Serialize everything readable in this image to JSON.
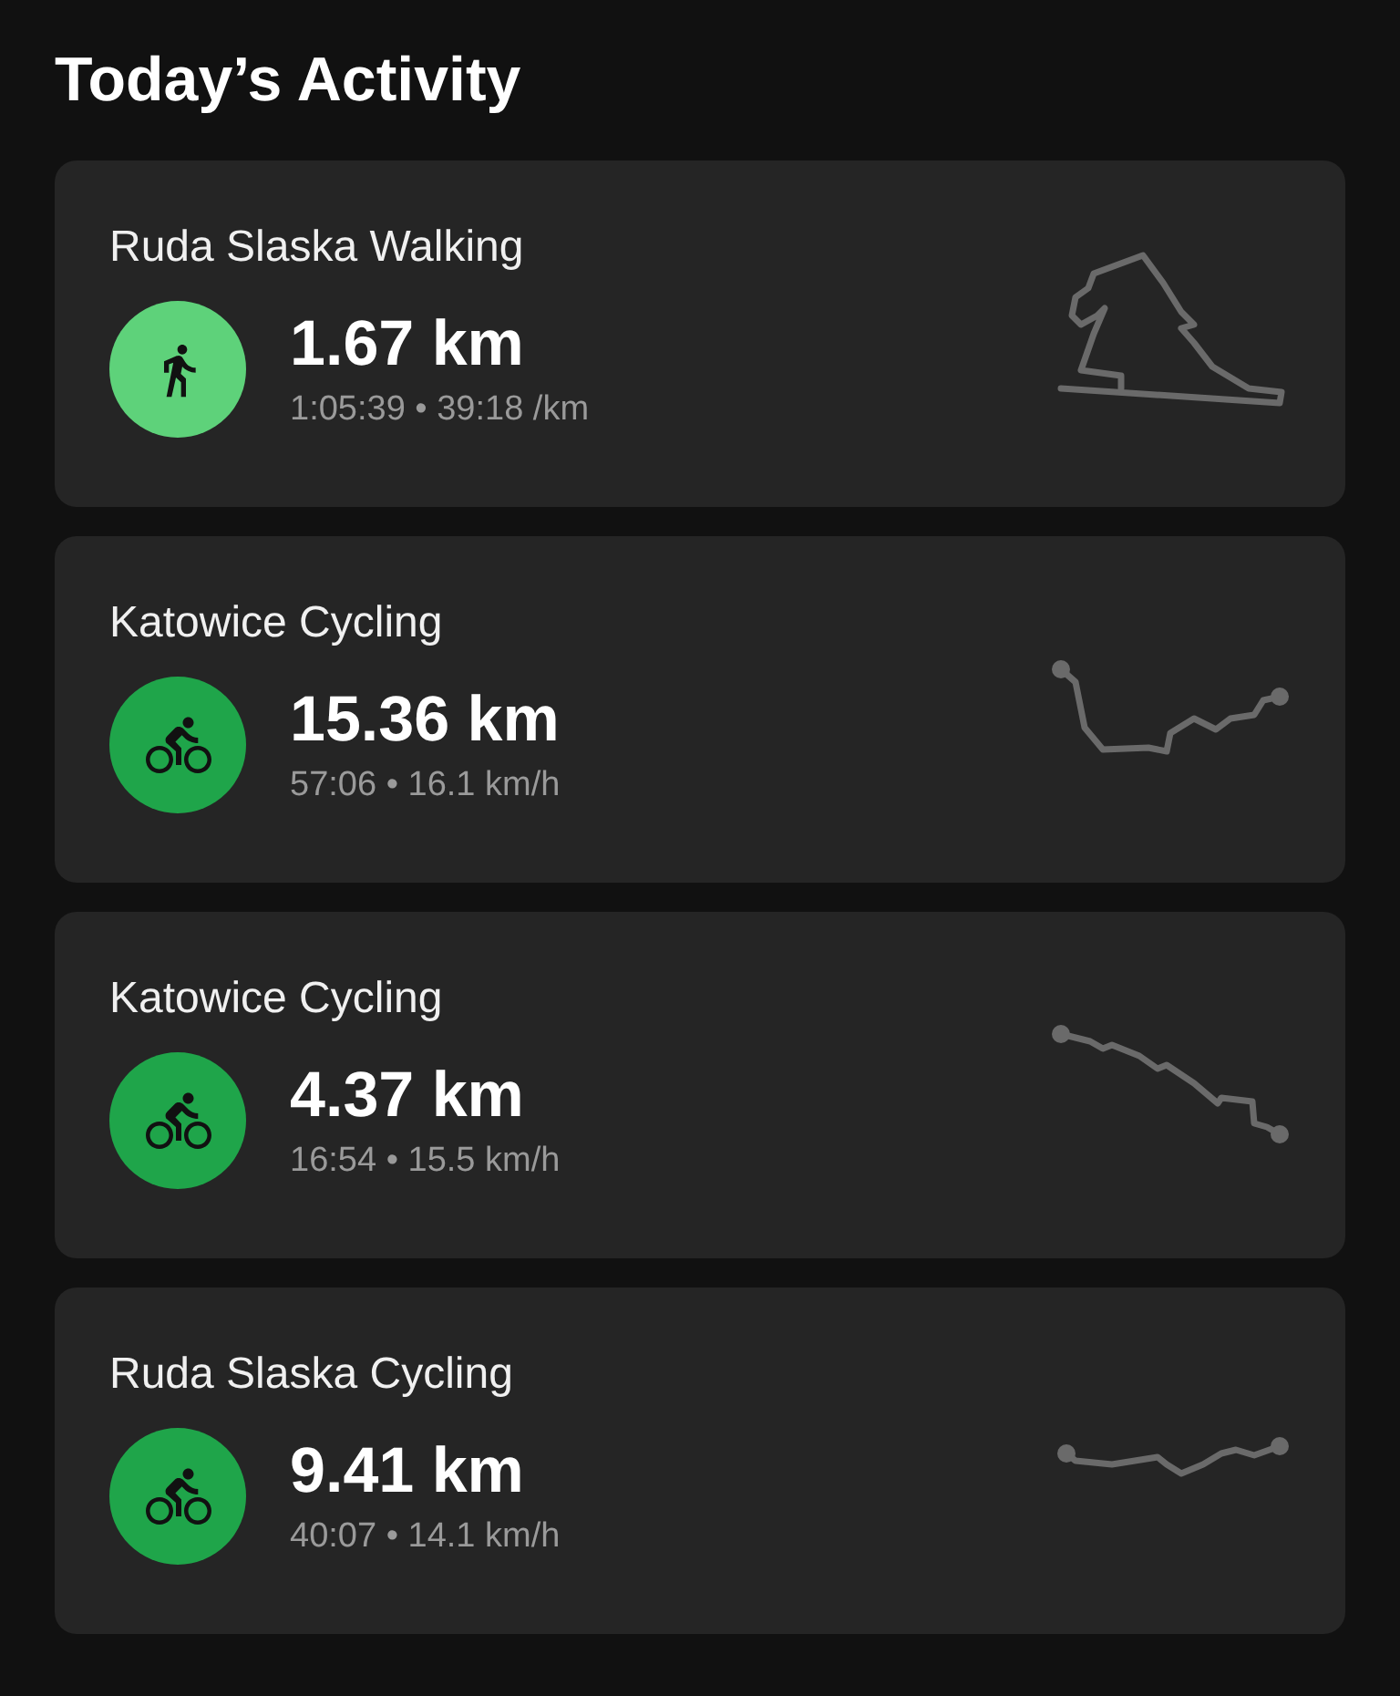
{
  "title": "Today’s Activity",
  "activities": [
    {
      "name": "Ruda Slaska Walking",
      "kind": "walking",
      "color": "#5ed27a",
      "distance": "1.67 km",
      "details": "1:05:39 • 39:18 /km"
    },
    {
      "name": "Katowice Cycling",
      "kind": "cycling",
      "color": "#1fa54a",
      "distance": "15.36 km",
      "details": "57:06 • 16.1 km/h"
    },
    {
      "name": "Katowice Cycling",
      "kind": "cycling",
      "color": "#1fa54a",
      "distance": "4.37 km",
      "details": "16:54 • 15.5 km/h"
    },
    {
      "name": "Ruda Slaska Cycling",
      "kind": "cycling",
      "color": "#1fa54a",
      "distance": "9.41 km",
      "details": "40:07 • 14.1 km/h"
    }
  ]
}
